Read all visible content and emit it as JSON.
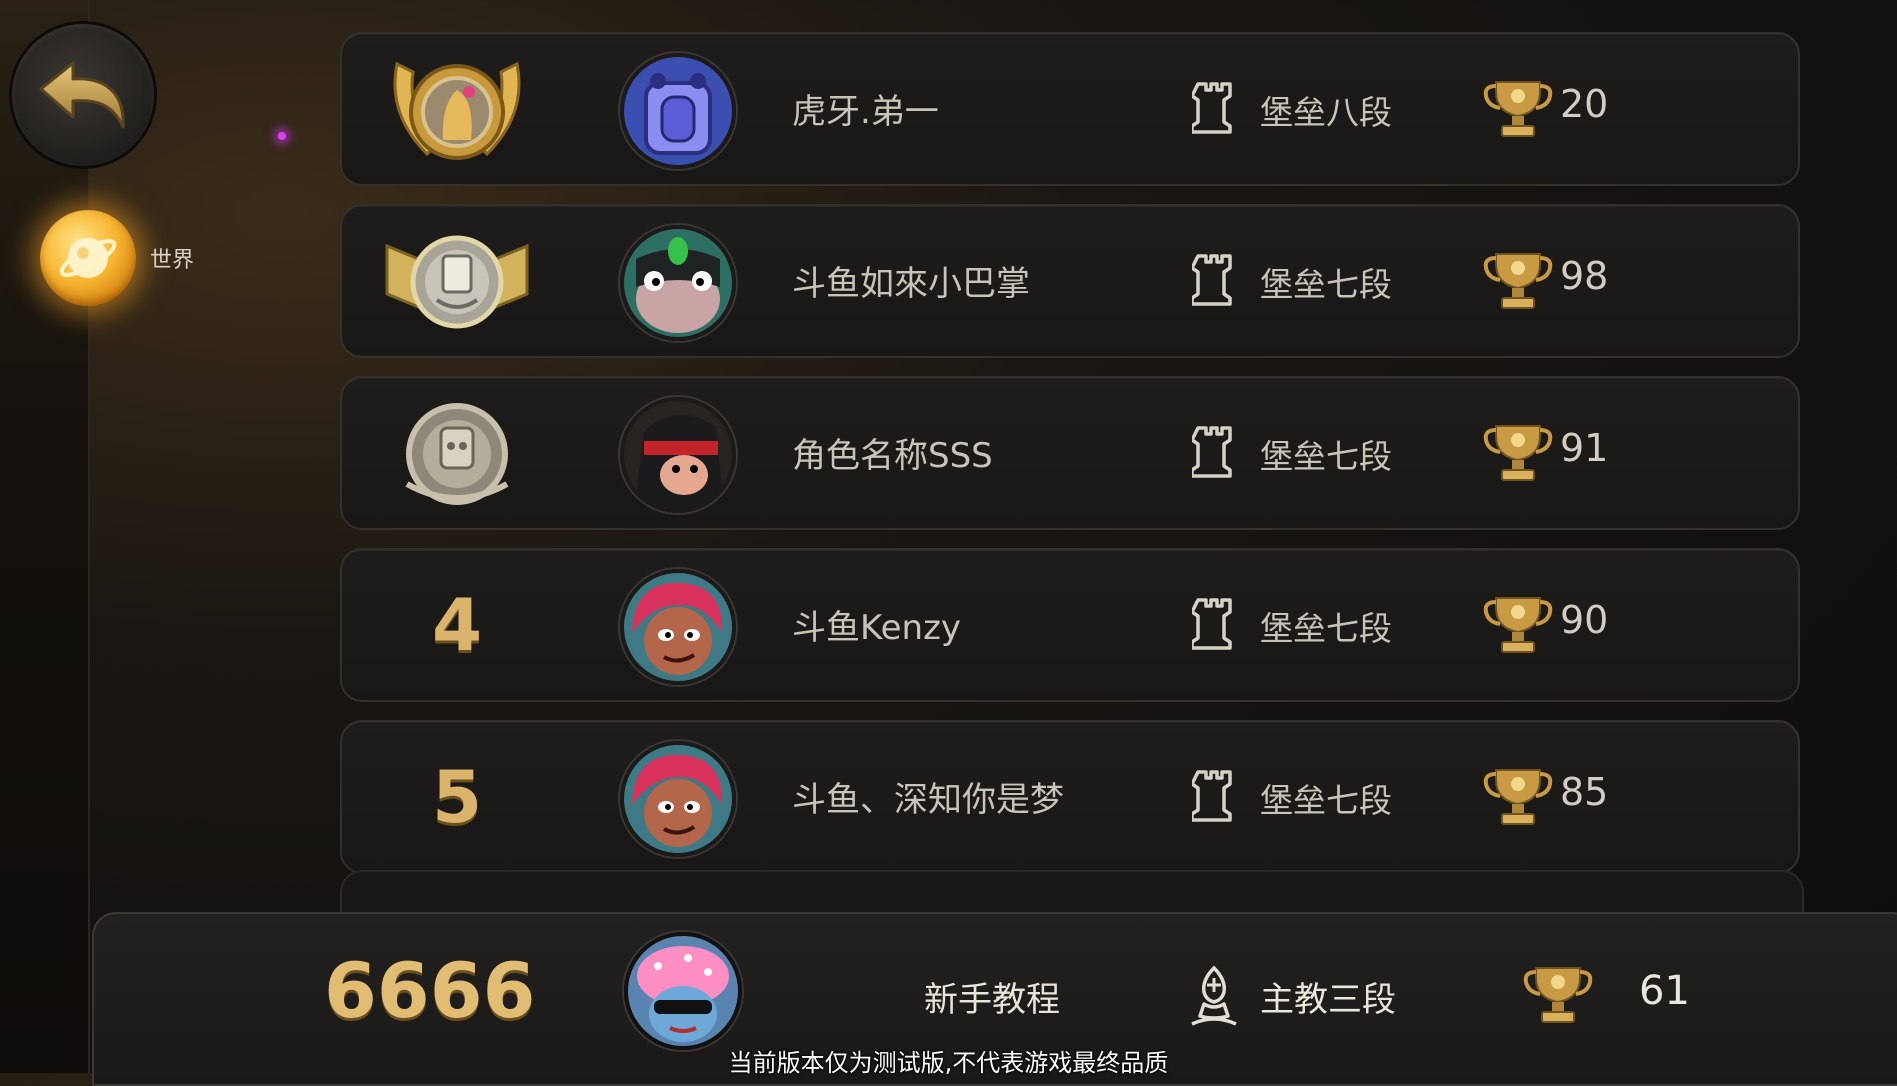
{
  "sidebar": {
    "world_label": "世界"
  },
  "leaderboard": [
    {
      "rank": "1",
      "badge": "gold-laurel-badge",
      "name": "虎牙.弟一",
      "tier": "堡垒八段",
      "score": "20"
    },
    {
      "rank": "2",
      "badge": "silver-winged-badge",
      "name": "斗鱼如來小巴掌",
      "tier": "堡垒七段",
      "score": "98"
    },
    {
      "rank": "3",
      "badge": "bronze-badge",
      "name": "角色名称SSS",
      "tier": "堡垒七段",
      "score": "91"
    },
    {
      "rank": "4",
      "badge": "",
      "name": "斗鱼Kenzy",
      "tier": "堡垒七段",
      "score": "90"
    },
    {
      "rank": "5",
      "badge": "",
      "name": "斗鱼、深知你是梦",
      "tier": "堡垒七段",
      "score": "85"
    }
  ],
  "self": {
    "rank": "6666",
    "name": "新手教程",
    "tier": "主教三段",
    "score": "61"
  },
  "notice": "当前版本仅为测试版,不代表游戏最终品质",
  "colors": {
    "gold": "#d9b46a",
    "accent_orange": "#f7b531",
    "row_bg": "#1c1a18",
    "text": "#c9c3b8"
  }
}
